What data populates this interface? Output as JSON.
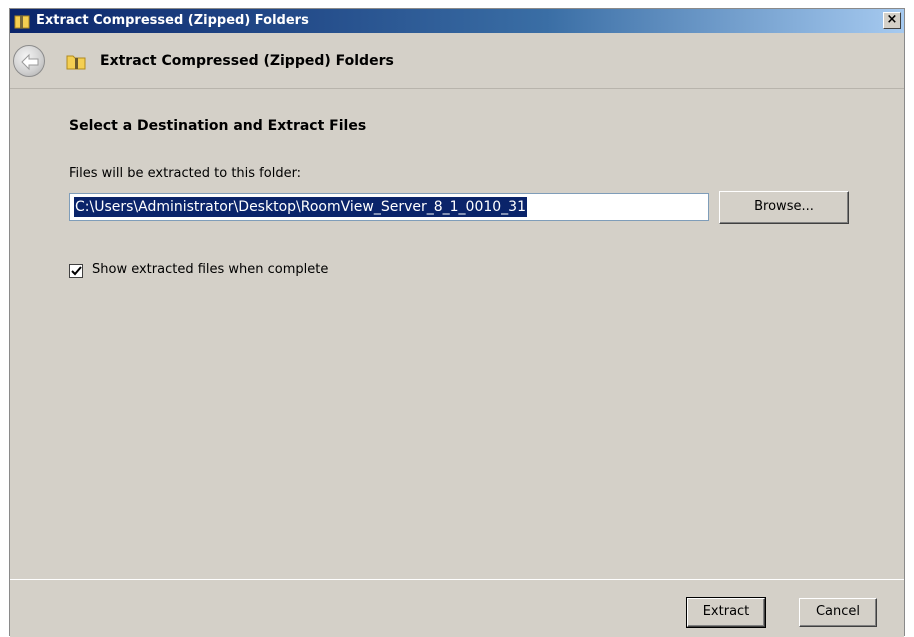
{
  "window": {
    "title": "Extract Compressed (Zipped) Folders",
    "close_label": "×"
  },
  "nav": {
    "title": "Extract Compressed (Zipped) Folders"
  },
  "content": {
    "heading": "Select a Destination and Extract Files",
    "field_label": "Files will be extracted to this folder:",
    "path_value": "C:\\Users\\Administrator\\Desktop\\RoomView_Server_8_1_0010_31",
    "browse_label": "Browse...",
    "checkbox_label": "Show extracted files when complete",
    "checkbox_checked": true
  },
  "footer": {
    "extract_label": "Extract",
    "cancel_label": "Cancel"
  },
  "colors": {
    "titlebar_start": "#0a246a",
    "selection": "#0a246a",
    "dialog_bg": "#d4d0c8"
  }
}
